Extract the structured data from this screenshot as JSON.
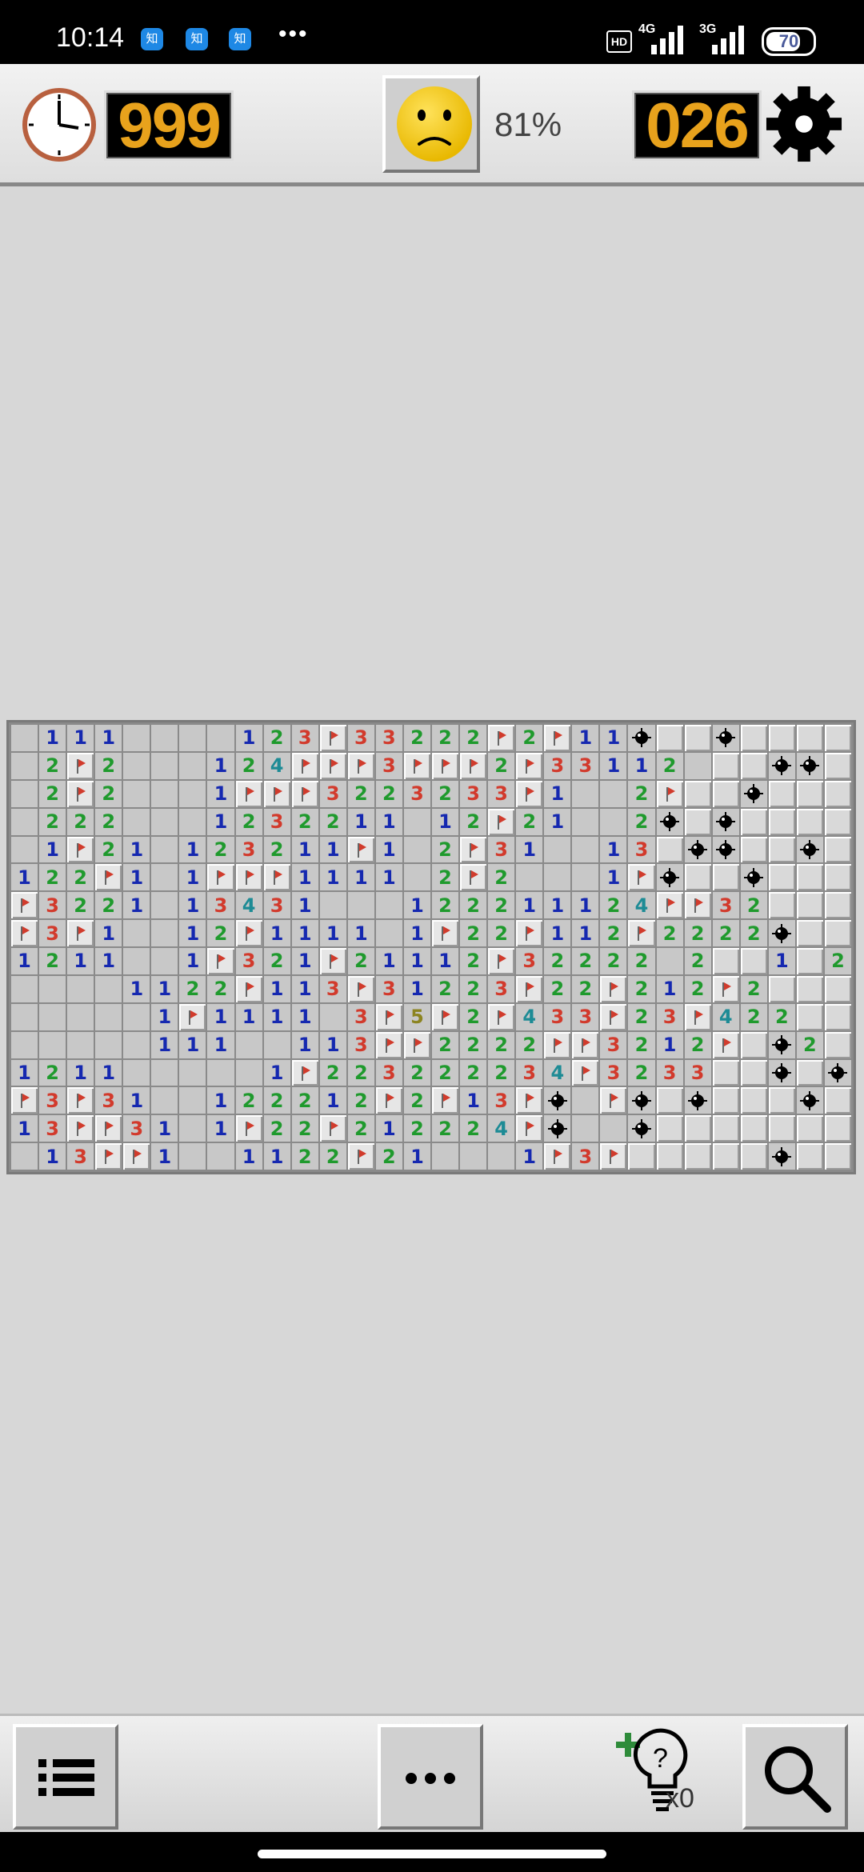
{
  "status_bar": {
    "time": "10:14",
    "notifications": [
      "知",
      "知",
      "知"
    ],
    "more": "•••",
    "hd": "HD",
    "network_1": "4G",
    "network_2": "3G",
    "battery": "70"
  },
  "header": {
    "timer": "999",
    "progress": "81%",
    "mines_left": "026",
    "face_state": "frown"
  },
  "board": {
    "columns": 30,
    "rows": 16,
    "legend": "chars: 0 = opened empty, 1-5 = number, F = flag, M = revealed mine, X = exploded mine, . = unopened",
    "grid": [
      "0111000012 3F3 3222F2F11M..M..",
      "02F2000124FFF3FFF2F331120..MM.M.",
      "02F2000 1FFF3223233F1002F..M..",
      "0222000123221101 2F21002M.M...",
      "01F21012 321 1F1 02F31001 3.MM..M",
      "12 2F101 FFF1111 02F2000 1FM..M..",
      "F3221013 43100012 2211124FF32..",
      "F3F100 12F11110 1F22F112F2222M..M",
      "1211001F3 21F2111 2F3222202..1.2X",
      "00001122F113F31223F22F2 12F2...",
      "000001F1 11103F5F2F433F23F422...",
      "000001110011 3FF2222FF3212F.M2..",
      "1211000001F2232222 34F3233..M.M.",
      "F3F3100122212 F2F13FM0FM.M...M",
      "13FF3101F22F212224FM00M.....",
      "013FF1001122F210001F3F.....M.."
    ]
  }
}
